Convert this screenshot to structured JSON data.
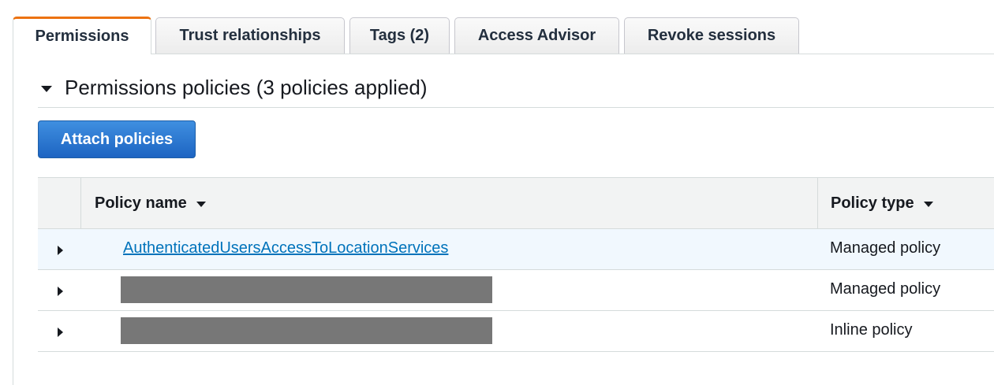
{
  "tabs": [
    {
      "label": "Permissions",
      "active": true
    },
    {
      "label": "Trust relationships"
    },
    {
      "label": "Tags (2)"
    },
    {
      "label": "Access Advisor"
    },
    {
      "label": "Revoke sessions"
    }
  ],
  "section": {
    "title": "Permissions policies (3 policies applied)",
    "attach_button": "Attach policies"
  },
  "table": {
    "columns": {
      "name": "Policy name",
      "type": "Policy type"
    },
    "rows": [
      {
        "name": "AuthenticatedUsersAccessToLocationServices",
        "type": "Managed policy"
      },
      {
        "name": "",
        "type": "Managed policy",
        "redacted": true
      },
      {
        "name": "",
        "type": "Inline policy",
        "redacted": true
      }
    ]
  },
  "colors": {
    "accent_tab": "#ec7211",
    "primary_button": "#1d64c2",
    "link": "#0073bb",
    "redaction": "#777777"
  }
}
